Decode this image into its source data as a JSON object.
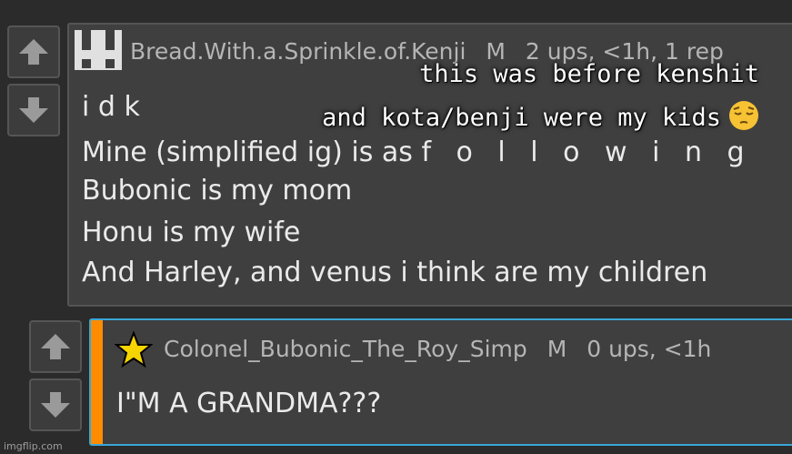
{
  "comments": [
    {
      "username": "Bread.With.a.Sprinkle.of.Kenji",
      "gender": "M",
      "stats": "2 ups, <1h, 1 rep",
      "lines": [
        "i d k",
        "Mine (simplified ig) is as ",
        "f o l l o w i n g",
        "Bubonic is my mom",
        "Honu is my wife",
        "And Harley, and venus i think are my children"
      ],
      "vote_up_icon": "arrow-up-icon",
      "vote_down_icon": "arrow-down-icon",
      "avatar_icon": "pixel-avatar-icon"
    },
    {
      "username": "Colonel_Bubonic_The_Roy_Simp",
      "gender": "M",
      "stats": "0 ups, <1h",
      "text": "I\"M A GRANDMA???",
      "avatar_icon": "star-icon"
    }
  ],
  "overlay": {
    "line1": "this was before kenshit",
    "line2": "and kota/benji were my kids",
    "emoji": "pensive-face-emoji"
  },
  "watermark": "imgflip.com",
  "colors": {
    "accent_bar": "#ff8c00",
    "reply_border": "#3aa7d6",
    "star": "#f5d400"
  }
}
